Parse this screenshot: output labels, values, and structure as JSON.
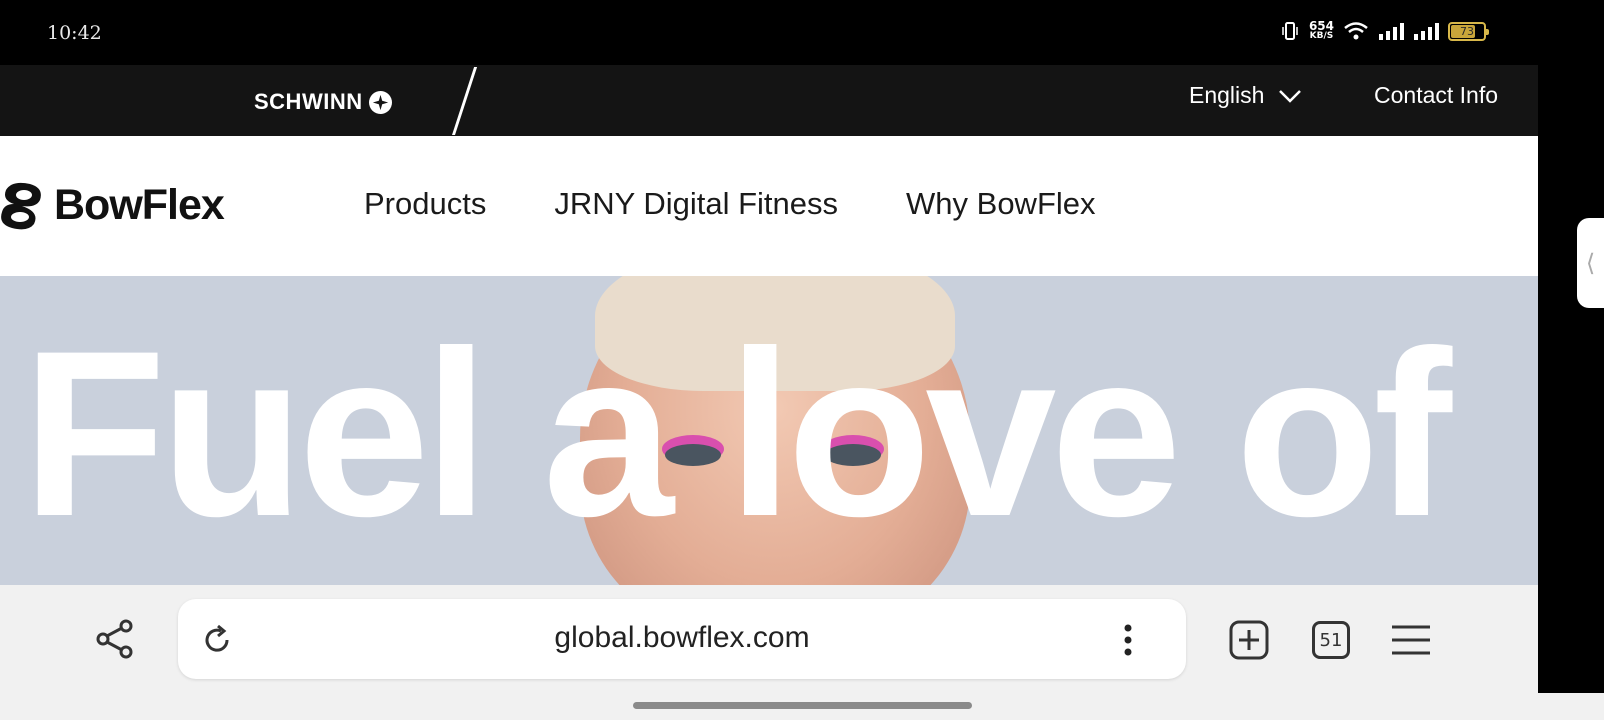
{
  "status_bar": {
    "time": "10:42",
    "net_speed_value": "654",
    "net_speed_unit": "KB/S",
    "battery_level": "73"
  },
  "site_topbar": {
    "brand": "SCHWINN",
    "language": "English",
    "contact": "Contact Info"
  },
  "navbar": {
    "logo_text": "BowFlex",
    "items": [
      "Products",
      "JRNY Digital Fitness",
      "Why BowFlex"
    ]
  },
  "hero": {
    "headline": "Fuel a love of"
  },
  "browser": {
    "url": "global.bowflex.com",
    "tab_count": "51"
  },
  "colors": {
    "topbar_bg": "#141414",
    "hero_bg": "#c9d0dc",
    "browser_bar_bg": "#f1f1f1"
  }
}
